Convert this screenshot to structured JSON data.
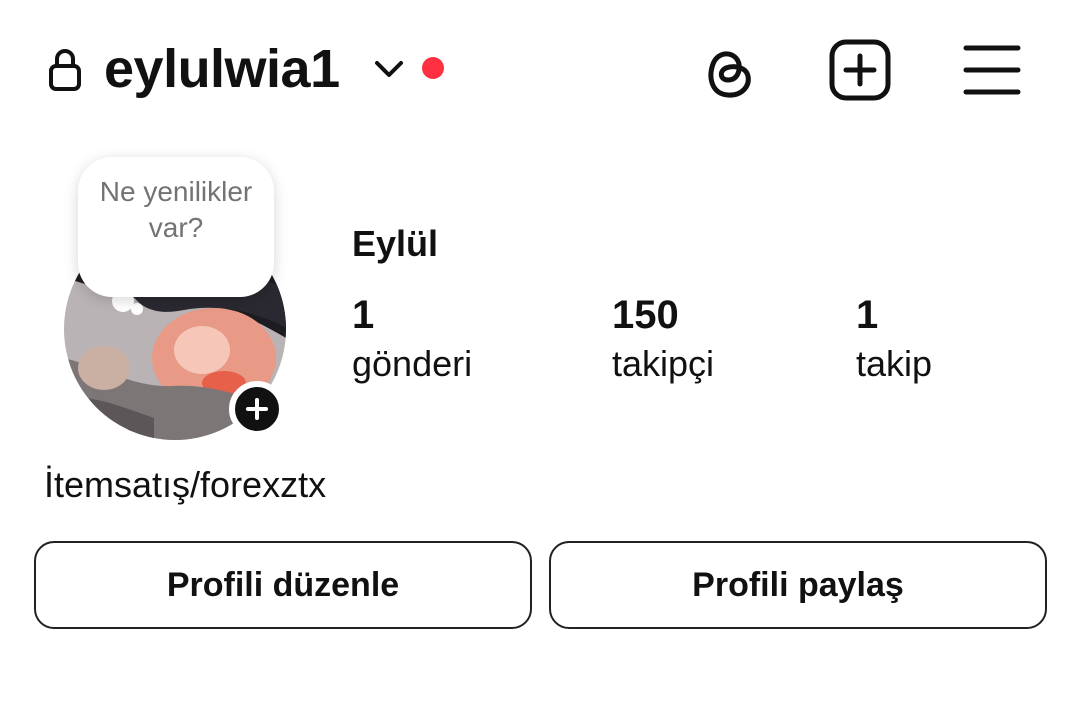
{
  "header": {
    "username": "eylulwia1",
    "lock_icon": "lock-icon",
    "account_switch_icon": "chevron-down-icon",
    "notification_dot_color": "#ff3040",
    "actions": [
      "threads-icon",
      "create-plus-icon",
      "menu-hamburger-icon"
    ]
  },
  "note": {
    "placeholder": "Ne yenilikler var?"
  },
  "profile": {
    "display_name": "Eylül",
    "bio": "İtemsatış/forexztx",
    "avatar_icon": "add-story-plus-icon"
  },
  "stats": {
    "posts": {
      "value": "1",
      "label": "gönderi"
    },
    "followers": {
      "value": "150",
      "label": "takipçi"
    },
    "following": {
      "value": "1",
      "label": "takip"
    }
  },
  "buttons": {
    "edit_profile": "Profili düzenle",
    "share_profile": "Profili paylaş"
  }
}
